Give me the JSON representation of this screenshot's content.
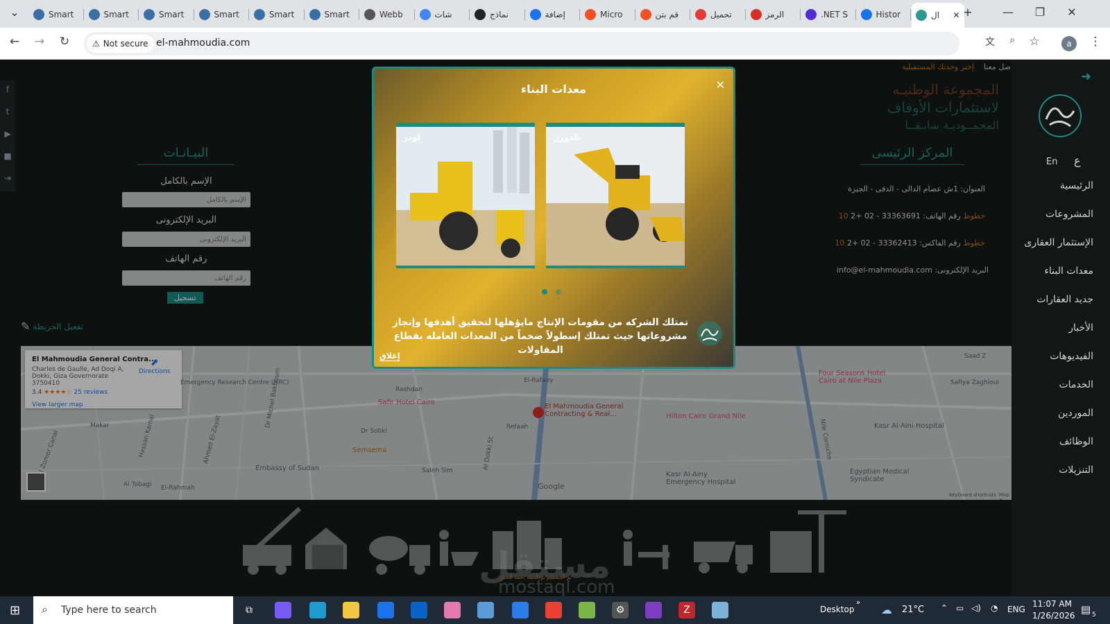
{
  "browser": {
    "tabs": [
      {
        "label": "Smart"
      },
      {
        "label": "Smart"
      },
      {
        "label": "Smart"
      },
      {
        "label": "Smart"
      },
      {
        "label": "Smart"
      },
      {
        "label": "Smart"
      },
      {
        "label": "Webb"
      },
      {
        "label": "شات"
      },
      {
        "label": "نماذج"
      },
      {
        "label": "إضافة"
      },
      {
        "label": "Micro"
      },
      {
        "label": "قم بتن"
      },
      {
        "label": "تحميل"
      },
      {
        "label": "الرمز"
      },
      {
        "label": ".NET S"
      },
      {
        "label": "Histor"
      },
      {
        "label": "ال"
      }
    ],
    "security_label": "Not secure",
    "url": "el-mahmoudia.com",
    "profile_initial": "a"
  },
  "site": {
    "top_links": [
      "إختر وحدتك المستقبلية",
      "صل معنا"
    ],
    "brand_lines": [
      "المجموعة الوطنيـه",
      "لاستثمارات الأوقاف",
      "المحمــوديـة سابـقــا"
    ],
    "lang": {
      "en": "En",
      "ar": "ع"
    },
    "nav": [
      "الرئيسية",
      "المشروعات",
      "الإستثمار العقارى",
      "معدات البناء",
      "جديد العقارات",
      "الأخبار",
      "الفيديوهات",
      "الخدمات",
      "الموردين",
      "الوظائف",
      "التنزيلات"
    ],
    "hq": {
      "title": "المركز الرئيسى",
      "address": "العنوان: 1ش عصام الدالى - الدقى - الجيزة",
      "phone_label": "رقم الهاتف: 33363691 - 02 +2",
      "phone_suffix": "10 خطوط",
      "fax_label": "رقم الفاكس: 33362413 - 02 +2",
      "fax_suffix": "10 خطوط",
      "email": "info@el-mahmoudia.com :البريد الإلكترونى"
    },
    "form": {
      "title": "البيـانـات",
      "name_label": "الإسم بالكامل",
      "name_placeholder": "الإسم بالكامل",
      "email_label": "البريد الإلكترونى",
      "email_placeholder": "البريد الإلكترونى",
      "phone_label": "رقم الهاتف",
      "phone_placeholder": "رقم الهاتف",
      "submit": "تسجيل"
    },
    "map_toggle": "تفعيل الخريطة",
    "map": {
      "place_name": "El Mahmoudia General Contra...",
      "place_address": "Charles de Gaulle, Ad Doqi A, Dokki, Giza Governorate 3750410",
      "rating": "3.4",
      "reviews": "25 reviews",
      "directions": "Directions",
      "larger_map": "View larger map",
      "pin_label": "El Mahmoudia General Contracting & Real...",
      "pois": [
        "Four Seasons Hotel Cairo at Nile Plaza",
        "Safir Hotel Cairo",
        "Hilton Cairo Grand Nile",
        "Semsema",
        "Embassy of Sudan",
        "Egyptian Medical Syndicate",
        "Kasr Al-Ainy Emergency Hospital",
        "Kasr Al-Aini Hospital",
        "Nile Corniche"
      ],
      "streets": [
        "Rashdan",
        "El-Rafaey",
        "Refaah",
        "Dr Sobki",
        "Al Dokki St",
        "Saleh Sim",
        "Al Tobagi",
        "Makar",
        "El-Rahmah",
        "Al Zomor Canal",
        "Hassan Kamal",
        "Dr Michel Bakhoum",
        "Ahmed El-Zayat",
        "Safiya Zaghloul",
        "Saad Z",
        "Emergency Research Centre (NRC)"
      ],
      "google": "Google",
      "footer_links": [
        "Keyboard shortcuts",
        "Map d"
      ]
    },
    "footer_credit": "تم التصميم بواسطة احمد مختار"
  },
  "modal": {
    "title": "معدات البناء",
    "cards": [
      {
        "label": "بلدوزر"
      },
      {
        "label": "لودر"
      }
    ],
    "description": "تمتلك الشركه من مقومات الإنتاج مايؤهلها لتحقيق أهدفها وإنجاز مشروعاتها حيث تمتلك إسطولاً ضخماً من المعدات العامله بقطاع المقاولات",
    "close": "إغلاق",
    "slide_count": 2,
    "active_slide": 1
  },
  "watermark": {
    "text_ar": "مستقل",
    "text_en": "mostaql.com"
  },
  "taskbar": {
    "search_placeholder": "Type here to search",
    "desktop": "Desktop",
    "temperature": "21°C",
    "lang": "ENG",
    "time": "11:07 AM",
    "date": "1/26/2026",
    "notif_count": "5"
  },
  "colors": {
    "accent": "#1f8a82",
    "brand_orange": "#c8761a",
    "brand_rust": "#b8532e",
    "page_bg": "#141b1a"
  }
}
